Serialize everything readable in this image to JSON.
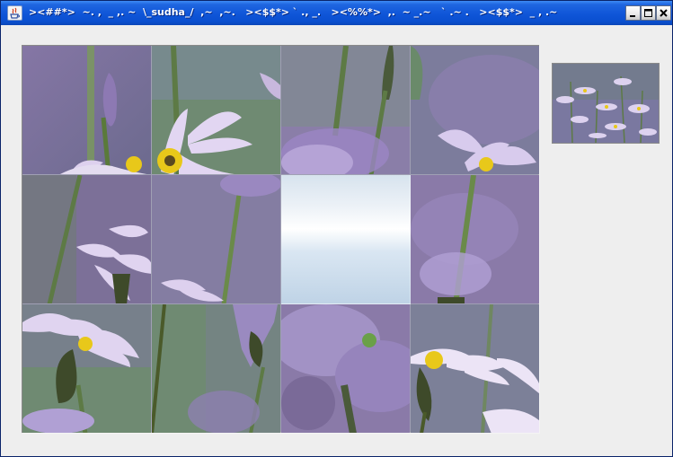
{
  "window": {
    "title": "><##*>  ~. ,  _ ,. ~  \\_sudha_/  ,~  ,~.   ><$$*> ` ., _.   ><%%*>  ,.  ~ _.~   ` .~ .   ><$$*>  _ , .~",
    "controls": {
      "minimize_icon": "minimize-icon",
      "maximize_icon": "maximize-icon",
      "close_icon": "close-icon"
    }
  },
  "puzzle": {
    "rows": 3,
    "cols": 4,
    "empty_tile": {
      "row": 1,
      "col": 2
    },
    "colors": {
      "petal": "#c9b8e0",
      "petal_dark": "#9b86c4",
      "stem": "#5a7a3a",
      "center": "#e8c81a",
      "bg_purple": "#8a7aa8",
      "bg_green": "#6f8a72",
      "empty_tile_top": "#d7e3ee",
      "empty_tile_bottom": "#bfd3e6"
    }
  }
}
